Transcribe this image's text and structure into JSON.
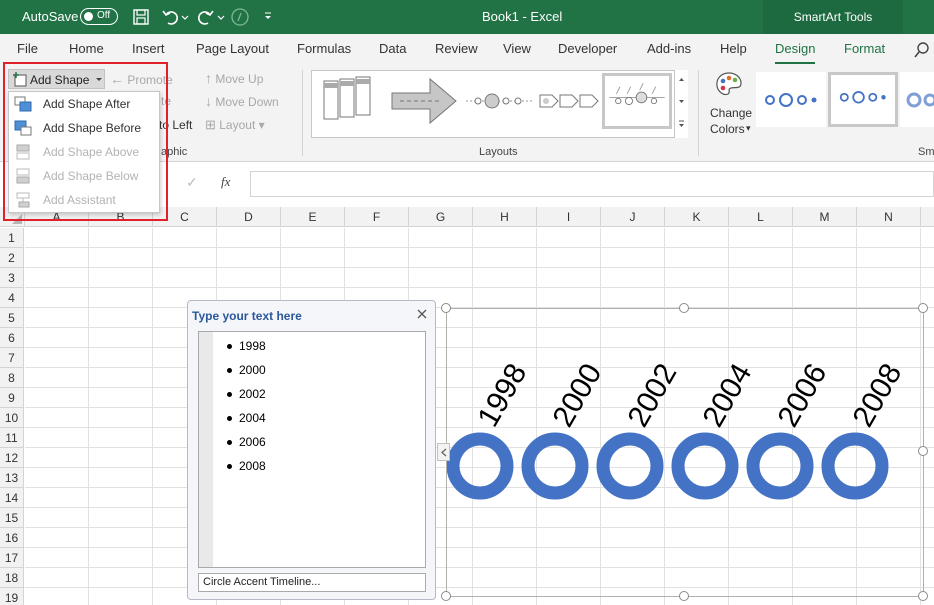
{
  "titlebar": {
    "autosave_label": "AutoSave",
    "toggle_state": "Off",
    "document_title": "Book1  -  Excel",
    "contextual_tools": "SmartArt Tools",
    "colors": {
      "bar": "#217346",
      "tools_bg": "#1d6a40"
    }
  },
  "ribbon_tabs": [
    "File",
    "Home",
    "Insert",
    "Page Layout",
    "Formulas",
    "Data",
    "Review",
    "View",
    "Developer",
    "Add-ins",
    "Help",
    "Design",
    "Format"
  ],
  "ribbon": {
    "add_shape": "Add Shape",
    "promote": "Promote",
    "demote_partial": "te",
    "right_to_left_partial": "to Left",
    "move_up": "Move Up",
    "move_down": "Move Down",
    "layout": "Layout",
    "create_graphic_partial": "aphic",
    "layouts_group": "Layouts",
    "change_colors": "Change",
    "change_colors2": "Colors",
    "smartart_styles_partial": "Sm"
  },
  "add_shape_menu": {
    "items": [
      {
        "label": "Add Shape After",
        "enabled": true
      },
      {
        "label": "Add Shape Before",
        "enabled": true
      },
      {
        "label": "Add Shape Above",
        "enabled": false
      },
      {
        "label": "Add Shape Below",
        "enabled": false
      },
      {
        "label": "Add Assistant",
        "enabled": false
      }
    ],
    "highlight_color": "#e0202a"
  },
  "formula_bar": {
    "fx": "fx"
  },
  "columns": [
    "A",
    "B",
    "C",
    "D",
    "E",
    "F",
    "G",
    "H",
    "I",
    "J",
    "K",
    "L",
    "M",
    "N"
  ],
  "rows": [
    "1",
    "2",
    "3",
    "4",
    "5",
    "6",
    "7",
    "8",
    "9",
    "10",
    "11",
    "12",
    "13",
    "14",
    "15",
    "16",
    "17",
    "18",
    "19"
  ],
  "text_pane": {
    "title": "Type your text here",
    "items": [
      "1998",
      "2000",
      "2002",
      "2004",
      "2006",
      "2008"
    ],
    "footer": "Circle Accent Timeline..."
  },
  "smartart": {
    "years": [
      "1998",
      "2000",
      "2002",
      "2004",
      "2006",
      "2008"
    ],
    "ring_color": "#4472c4"
  }
}
